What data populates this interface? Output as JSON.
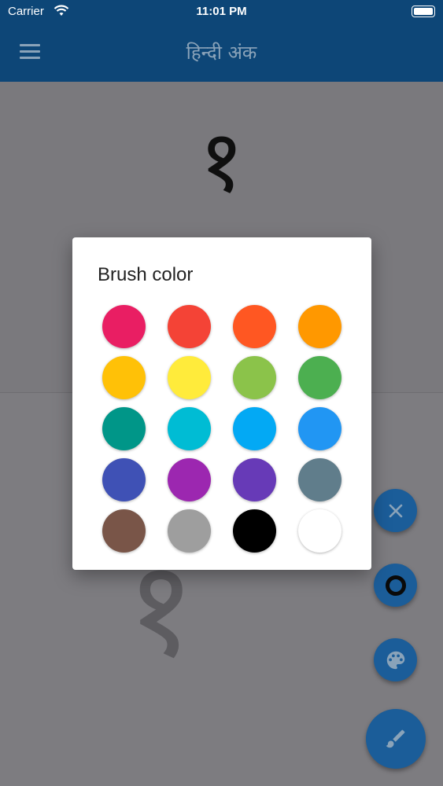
{
  "status_bar": {
    "carrier": "Carrier",
    "time": "11:01 PM"
  },
  "app_bar": {
    "title": "हिन्दी अंक",
    "menu_icon": "hamburger-menu-icon"
  },
  "practice": {
    "digit": "१",
    "trace_digit": "१"
  },
  "dialog": {
    "title": "Brush color",
    "swatches": [
      "#e91e63",
      "#f44336",
      "#ff5722",
      "#ff9800",
      "#ffc107",
      "#ffeb3b",
      "#8bc34a",
      "#4caf50",
      "#009688",
      "#00bcd4",
      "#03a9f4",
      "#2196f3",
      "#3f51b5",
      "#9c27b0",
      "#673ab7",
      "#607d8b",
      "#795548",
      "#9e9e9e",
      "#000000",
      "#ffffff"
    ]
  },
  "fabs": {
    "close_icon": "close-icon",
    "circle_icon": "circle-outline-icon",
    "palette_icon": "palette-icon",
    "brush_icon": "brush-icon",
    "color": "#1b5d99"
  }
}
